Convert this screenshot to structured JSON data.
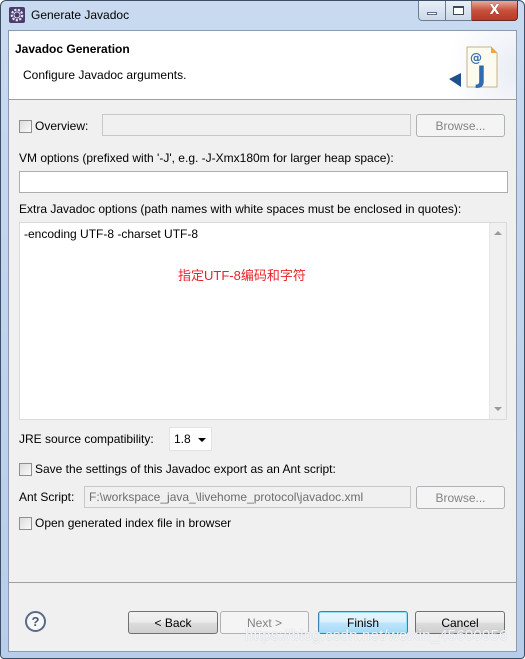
{
  "window": {
    "title": "Generate Javadoc",
    "icon": "eclipse-gear-icon",
    "controls": {
      "minimize": "minimize-icon",
      "maximize": "maximize-icon",
      "close": "close-icon",
      "close_glyph": "X"
    }
  },
  "header": {
    "title": "Javadoc Generation",
    "description": "Configure Javadoc arguments.",
    "icon": "javadoc-wizard-icon"
  },
  "overview": {
    "label": "Overview:",
    "checked": false,
    "value": "",
    "browse_label": "Browse..."
  },
  "vm_options": {
    "label": "VM options (prefixed with '-J', e.g. -J-Xmx180m for larger heap space):",
    "value": ""
  },
  "extra_options": {
    "label": "Extra Javadoc options (path names with white spaces must be enclosed in quotes):",
    "value": "-encoding UTF-8 -charset UTF-8",
    "annotation": "指定UTF-8编码和字符",
    "annotation_color": "#e8242a"
  },
  "jre": {
    "label": "JRE source compatibility:",
    "selected": "1.8"
  },
  "ant": {
    "save_label": "Save the settings of this Javadoc export as an Ant script:",
    "save_checked": false,
    "script_label": "Ant Script:",
    "script_value": "F:\\workspace_java_\\livehome_protocol\\javadoc.xml",
    "browse_label": "Browse..."
  },
  "open_index": {
    "label": "Open generated index file in browser",
    "checked": false
  },
  "footer": {
    "help_glyph": "?",
    "back_label": "< Back",
    "next_label": "Next >",
    "finish_label": "Finish",
    "cancel_label": "Cancel"
  },
  "watermark": "https://blog.csdn.net/weixin_45600956"
}
